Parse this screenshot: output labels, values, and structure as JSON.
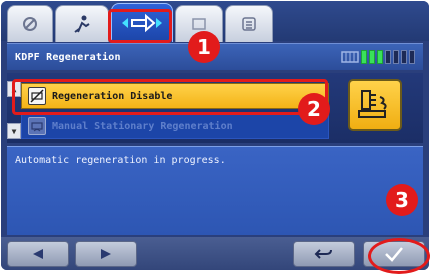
{
  "header": {
    "title": "KDPF Regeneration",
    "signal_level": 3,
    "signal_total": 7
  },
  "tabs": [
    {
      "icon": "no-entry-icon"
    },
    {
      "icon": "person-icon"
    },
    {
      "icon": "arrow-right-icon",
      "active": true
    },
    {
      "icon": "tab-icon"
    },
    {
      "icon": "list-icon"
    }
  ],
  "list": {
    "items": [
      {
        "label": "Regeneration Disable",
        "icon": "regeneration-disable-icon",
        "selected": true
      },
      {
        "label": "Manual Stationary Regeneration",
        "icon": "manual-regeneration-icon",
        "selected": false
      }
    ]
  },
  "message": {
    "text": "Automatic regeneration in progress."
  },
  "bottom": {
    "prev_icon": "triangle-left-icon",
    "next_icon": "triangle-right-icon",
    "back_icon": "return-arrow-icon",
    "confirm_icon": "checkmark-icon"
  },
  "callouts": {
    "one": "1",
    "two": "2",
    "three": "3"
  },
  "colors": {
    "accent": "#e21b1b",
    "selected": "#f3b317",
    "panel": "#2a3f7c"
  }
}
